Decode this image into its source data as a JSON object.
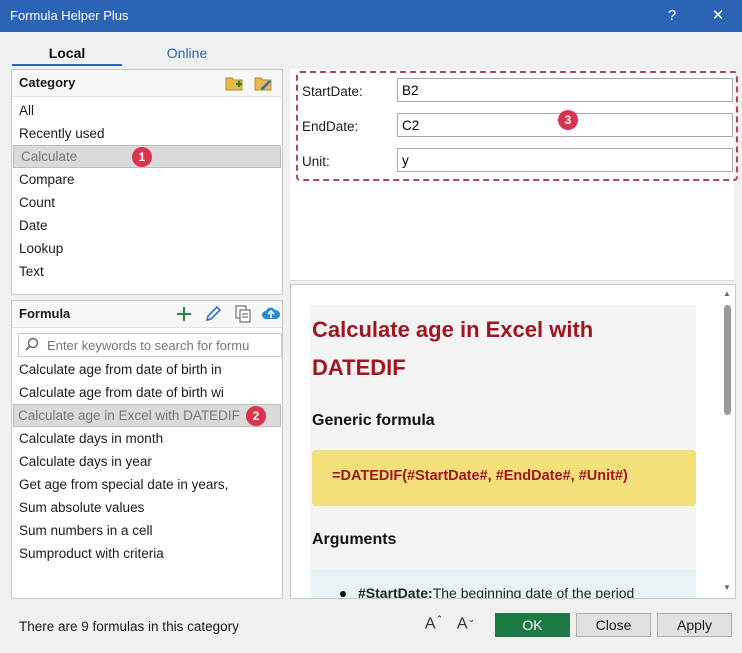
{
  "window": {
    "title": "Formula Helper Plus",
    "help_glyph": "?",
    "close_glyph": "✕"
  },
  "tabs": [
    {
      "label": "Local"
    },
    {
      "label": "Online"
    }
  ],
  "category": {
    "header": "Category",
    "items": [
      "All",
      "Recently used",
      "Calculate",
      "Compare",
      "Count",
      "Date",
      "Lookup",
      "Text"
    ],
    "selected": "Calculate",
    "badge": "1"
  },
  "formula": {
    "header": "Formula",
    "search_placeholder": "Enter keywords to search for formu",
    "items": [
      "Calculate age from date of birth in",
      "Calculate age from date of birth wi",
      "Calculate age in Excel with DATEDIF",
      "Calculate days in month",
      "Calculate days in year",
      "Get age from special date in years,",
      "Sum absolute values",
      "Sum numbers in a cell",
      "Sumproduct with criteria"
    ],
    "selected": "Calculate age in Excel with DATEDIF",
    "badge": "2"
  },
  "arguments": {
    "badge": "3",
    "fields": [
      {
        "label": "StartDate:",
        "value": "B2"
      },
      {
        "label": "EndDate:",
        "value": "C2"
      },
      {
        "label": "Unit:",
        "value": "y"
      }
    ]
  },
  "help": {
    "title": "Calculate age in Excel with DATEDIF",
    "generic_heading": "Generic formula",
    "formula_text": "=DATEDIF(#StartDate#, #EndDate#, #Unit#)",
    "arguments_heading": "Arguments",
    "first_arg_name": "#StartDate:",
    "first_arg_desc": "The beginning date of the period"
  },
  "footer": {
    "status": "There are 9 formulas in this category",
    "ok": "OK",
    "close": "Close",
    "apply": "Apply"
  },
  "colors": {
    "titlebar": "#2b63b5",
    "badge": "#d9344c",
    "heading": "#a01620",
    "formula_bg": "#f4e07a",
    "ok_bg": "#1e7a44"
  },
  "icons": [
    "add-folder-icon",
    "edit-folder-icon",
    "add-icon",
    "edit-pencil-icon",
    "copy-icon",
    "cloud-upload-icon",
    "search-icon",
    "increase-font-icon",
    "decrease-font-icon"
  ]
}
